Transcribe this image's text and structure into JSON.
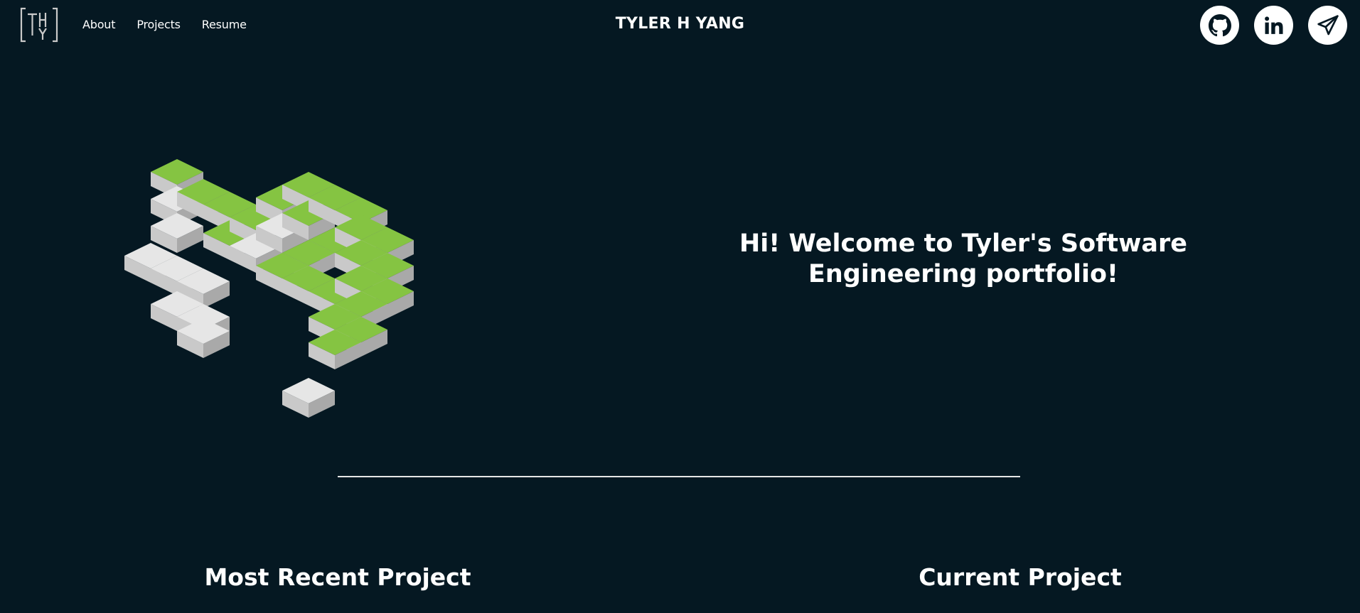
{
  "header": {
    "logo_text": "THY",
    "nav": [
      {
        "label": "About"
      },
      {
        "label": "Projects"
      },
      {
        "label": "Resume"
      }
    ],
    "title": "TYLER H YANG",
    "socials": [
      {
        "icon": "github-icon"
      },
      {
        "icon": "linkedin-icon"
      },
      {
        "icon": "send-icon"
      }
    ]
  },
  "hero": {
    "headline": "Hi! Welcome to Tyler's Software Engineering portfolio!"
  },
  "sections": {
    "recent_title": "Most Recent Project",
    "current_title": "Current Project"
  },
  "colors": {
    "background": "#051822",
    "accent_green": "#85c442",
    "cube_gray": "#e2e2e2"
  }
}
